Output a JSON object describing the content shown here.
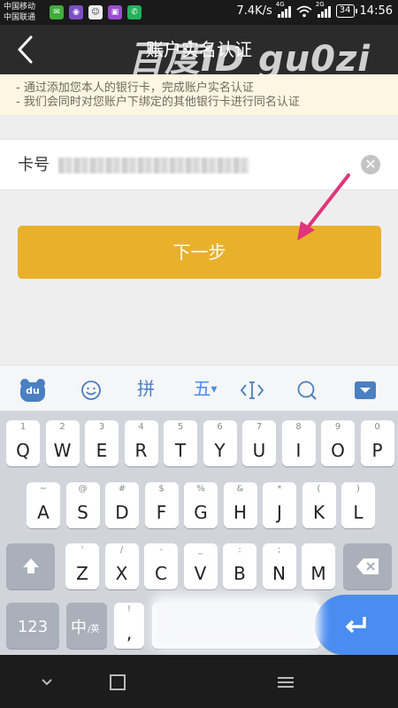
{
  "status_bar": {
    "carrier_1": "中国移动",
    "carrier_2": "中国联通",
    "speed": "7.4K/s",
    "network_1": "4G",
    "network_2": "2G",
    "battery": "34",
    "time": "14:56"
  },
  "header": {
    "title": "账户实名认证",
    "watermark": "百度ID gu0zi"
  },
  "notice": {
    "lines": [
      "- 通过添加您本人的银行卡，完成账户实名认证",
      "- 我们会同时对您账户下绑定的其他银行卡进行同名认证"
    ]
  },
  "form": {
    "card_label": "卡号"
  },
  "actions": {
    "next_label": "下一步"
  },
  "keyboard": {
    "toolbar": {
      "du_label": "du",
      "pinyin_label": "拼",
      "wubi_label": "五"
    },
    "row1": [
      {
        "sub": "1",
        "key": "Q"
      },
      {
        "sub": "2",
        "key": "W"
      },
      {
        "sub": "3",
        "key": "E"
      },
      {
        "sub": "4",
        "key": "R"
      },
      {
        "sub": "5",
        "key": "T"
      },
      {
        "sub": "6",
        "key": "Y"
      },
      {
        "sub": "7",
        "key": "U"
      },
      {
        "sub": "8",
        "key": "I"
      },
      {
        "sub": "9",
        "key": "O"
      },
      {
        "sub": "0",
        "key": "P"
      }
    ],
    "row2": [
      {
        "sub": "~",
        "key": "A"
      },
      {
        "sub": "@",
        "key": "S"
      },
      {
        "sub": "#",
        "key": "D"
      },
      {
        "sub": "$",
        "key": "F"
      },
      {
        "sub": "%",
        "key": "G"
      },
      {
        "sub": "&",
        "key": "H"
      },
      {
        "sub": "*",
        "key": "J"
      },
      {
        "sub": "(",
        "key": "K"
      },
      {
        "sub": ")",
        "key": "L"
      }
    ],
    "row3": [
      {
        "sub": "'",
        "key": "Z"
      },
      {
        "sub": "/",
        "key": "X"
      },
      {
        "sub": "-",
        "key": "C"
      },
      {
        "sub": "_",
        "key": "V"
      },
      {
        "sub": ":",
        "key": "B"
      },
      {
        "sub": ";",
        "key": "N"
      },
      {
        "sub": "",
        "key": "M"
      }
    ],
    "num_label": "123",
    "lang_main": "中",
    "lang_sub": "/英",
    "punct_sub": "!",
    "punct_main": ","
  },
  "colors": {
    "accent": "#e9b02a",
    "enter": "#4a8cf0",
    "arrow": "#e0357a"
  }
}
